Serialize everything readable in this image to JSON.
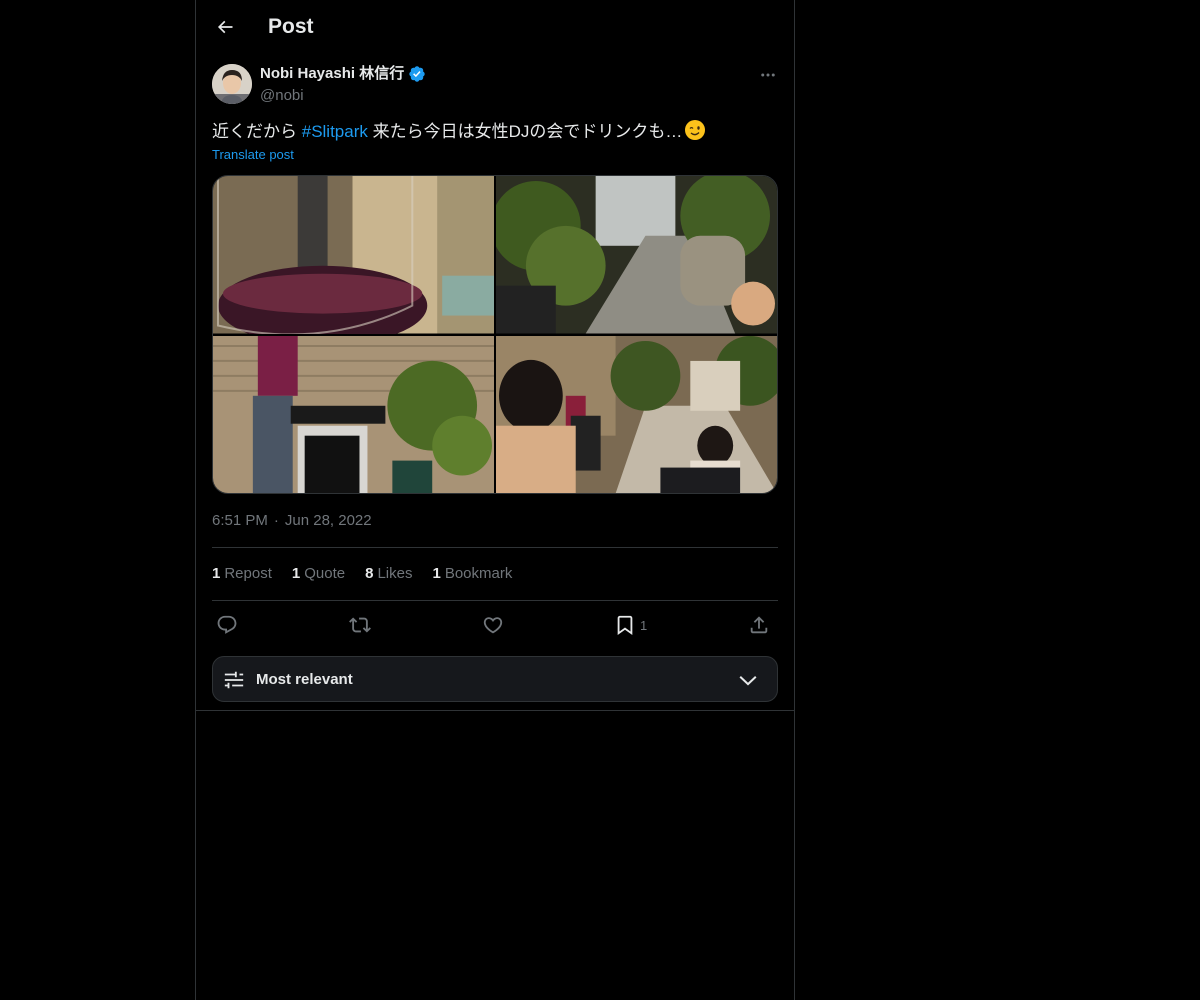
{
  "header": {
    "title": "Post",
    "back_icon": "arrow-left-icon"
  },
  "post": {
    "author": {
      "name": "Nobi Hayashi 林信行",
      "handle": "@nobi",
      "verified": true,
      "avatar_icon": "avatar-photo"
    },
    "text_before": "近くだから ",
    "hashtag": "#Slitpark",
    "text_after": " 来たら今日は女性DJの会でドリンクも…",
    "emoji_icon": "winking-face-icon",
    "translate_label": "Translate post",
    "media": [
      {
        "icon": "photo-wine-glass"
      },
      {
        "icon": "photo-garden-alley"
      },
      {
        "icon": "photo-dj-booth"
      },
      {
        "icon": "photo-party-crowd"
      }
    ],
    "time": "6:51 PM",
    "separator": "·",
    "date": "Jun 28, 2022"
  },
  "stats": [
    {
      "num": "1",
      "label": "Repost"
    },
    {
      "num": "1",
      "label": "Quote"
    },
    {
      "num": "8",
      "label": "Likes"
    },
    {
      "num": "1",
      "label": "Bookmark"
    }
  ],
  "actions": {
    "reply_icon": "reply-icon",
    "repost_icon": "repost-icon",
    "like_icon": "heart-icon",
    "bookmark_icon": "bookmark-icon",
    "bookmark_count": "1",
    "share_icon": "share-icon"
  },
  "reply_filter": {
    "label": "Most relevant",
    "icon": "sliders-icon",
    "chevron": "chevron-down-icon"
  },
  "colors": {
    "background": "#000000",
    "text": "#e7e9ea",
    "muted": "#71767b",
    "accent": "#1d9bf0",
    "border": "#2f3336"
  }
}
